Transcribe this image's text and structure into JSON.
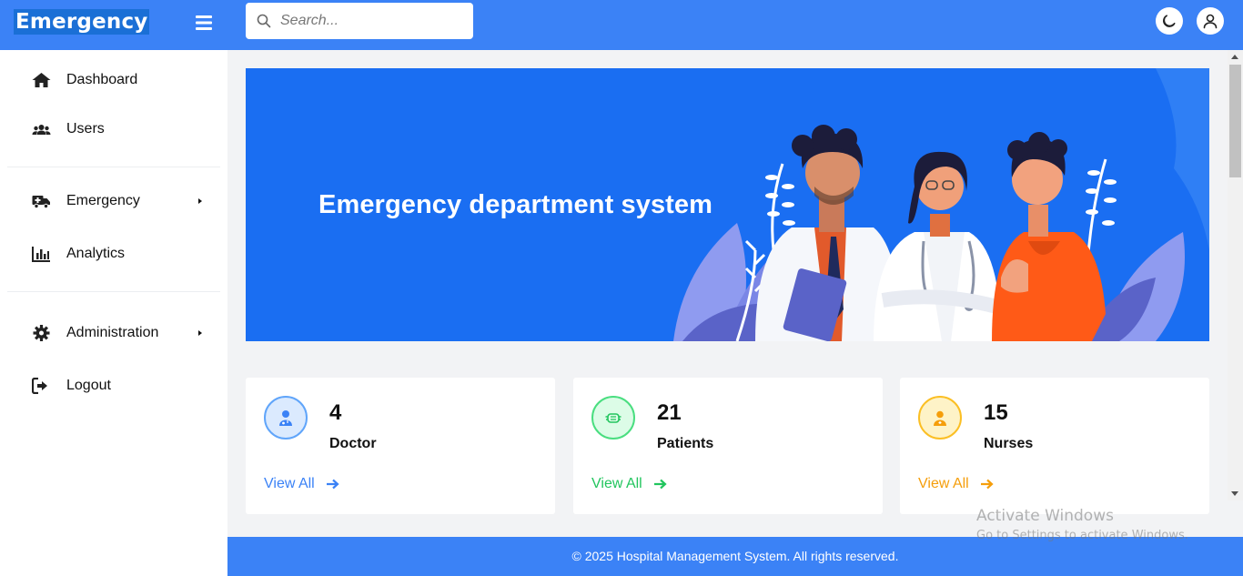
{
  "header": {
    "brand": "Emergency",
    "search_placeholder": "Search..."
  },
  "sidebar": {
    "items": [
      {
        "label": "Dashboard",
        "icon": "home-icon"
      },
      {
        "label": "Users",
        "icon": "users-icon"
      },
      {
        "label": "Emergency",
        "icon": "ambulance-icon",
        "has_submenu": true
      },
      {
        "label": "Analytics",
        "icon": "chart-bar-icon"
      },
      {
        "label": "Administration",
        "icon": "gear-icon",
        "has_submenu": true
      },
      {
        "label": "Logout",
        "icon": "logout-icon"
      }
    ]
  },
  "banner": {
    "title": "Emergency department system"
  },
  "cards": [
    {
      "count": "4",
      "label": "Doctor",
      "link": "View All",
      "color": "#3b82f6",
      "icon": "doctor-icon"
    },
    {
      "count": "21",
      "label": "Patients",
      "link": "View All",
      "color": "#22c55e",
      "icon": "patient-mask-icon"
    },
    {
      "count": "15",
      "label": "Nurses",
      "link": "View All",
      "color": "#f59e0b",
      "icon": "nurse-icon"
    }
  ],
  "footer": {
    "text": "© 2025 Hospital Management System. All rights reserved."
  },
  "watermark": {
    "line1": "Activate Windows",
    "line2": "Go to Settings to activate Windows."
  },
  "colors": {
    "primary": "#3b82f6",
    "banner": "#1a6ef2"
  }
}
